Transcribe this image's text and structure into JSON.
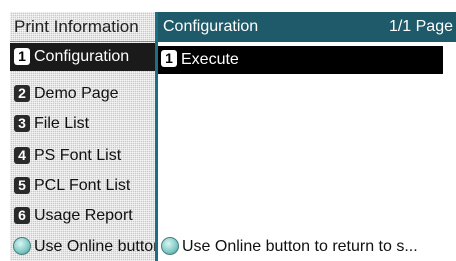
{
  "back_menu": {
    "title": "Print Information",
    "items": [
      {
        "num": "1",
        "label": "Configuration"
      },
      {
        "num": "2",
        "label": "Demo Page"
      },
      {
        "num": "3",
        "label": "File List"
      },
      {
        "num": "4",
        "label": "PS Font List"
      },
      {
        "num": "5",
        "label": "PCL Font List"
      },
      {
        "num": "6",
        "label": "Usage Report"
      }
    ],
    "footer": "Use Online button to return to standby"
  },
  "front_menu": {
    "title": "Configuration",
    "page": "1/1 Page",
    "items": [
      {
        "num": "1",
        "label": "Execute"
      }
    ],
    "footer": "Use Online button to return to s..."
  },
  "icons": {
    "online_button": "online-button-icon"
  },
  "colors": {
    "header_bg": "#1e5a6a",
    "selected_bg": "#000000",
    "border_accent": "#1a6f82"
  }
}
